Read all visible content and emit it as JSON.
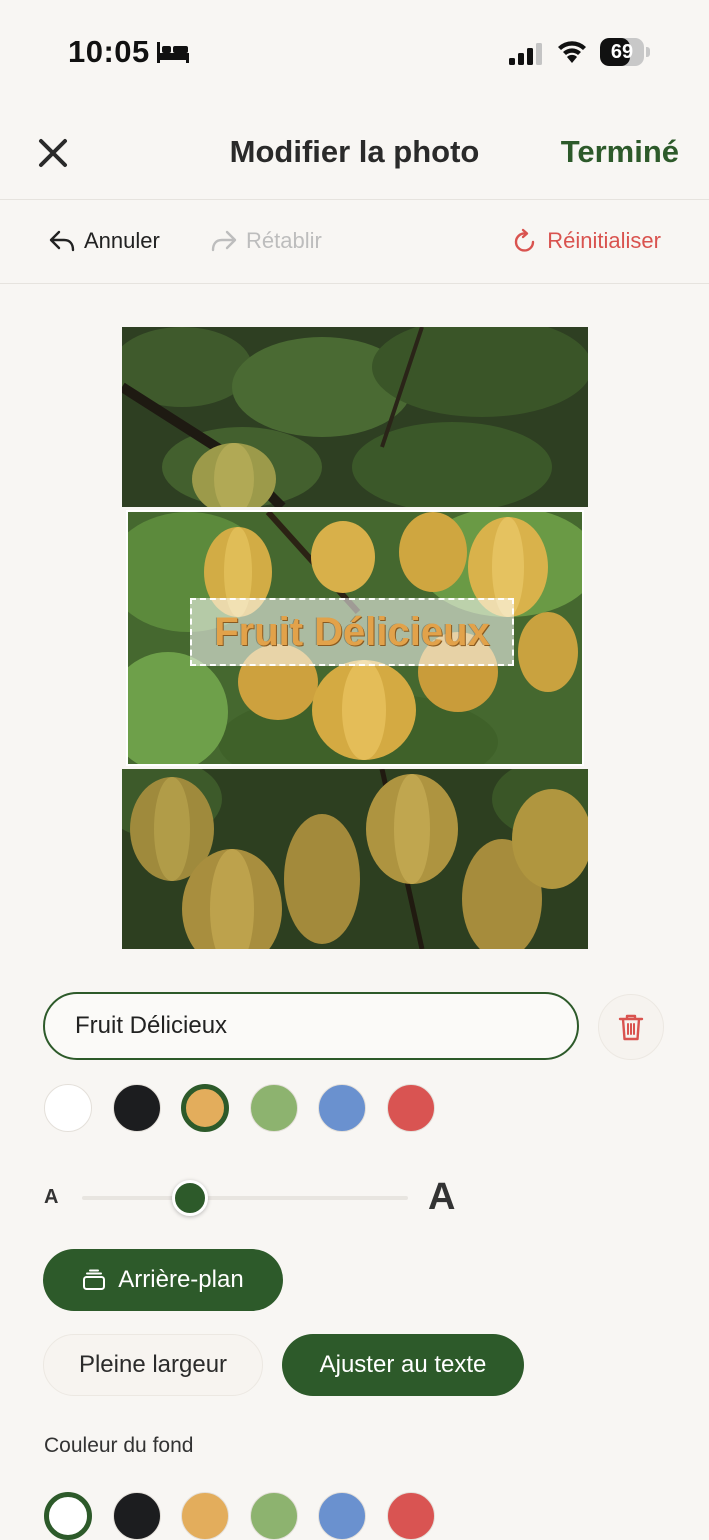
{
  "status_bar": {
    "time": "10:05",
    "battery_level": "69",
    "icons": [
      "bed-icon",
      "signal-icon",
      "wifi-icon",
      "battery-icon"
    ]
  },
  "header": {
    "title": "Modifier la photo",
    "done_label": "Terminé",
    "close_icon": "close-icon"
  },
  "toolbar": {
    "undo_label": "Annuler",
    "redo_label": "Rétablir",
    "reset_label": "Réinitialiser",
    "reset_color": "#d9534f"
  },
  "photo": {
    "overlay_text": "Fruit Délicieux"
  },
  "editor": {
    "text_value": "Fruit Délicieux",
    "text_colors": [
      "#ffffff",
      "#1c1d1f",
      "#e3ad5c",
      "#8db36f",
      "#6a91cf",
      "#d95452"
    ],
    "selected_text_color": 2,
    "size_small_label": "A",
    "size_large_label": "A",
    "size_level_percent": 33,
    "background_button_label": "Arrière-plan",
    "full_width_label": "Pleine largeur",
    "fit_text_label": "Ajuster au texte",
    "bg_color_label": "Couleur du fond",
    "bg_colors": [
      "#ffffff",
      "#1c1d1f",
      "#e3ad5c",
      "#8db36f",
      "#6a91cf",
      "#d95452"
    ],
    "selected_bg_color": 0
  },
  "colors": {
    "accent": "#2d5a2a",
    "danger": "#d9534f",
    "background": "#f8f6f3"
  }
}
